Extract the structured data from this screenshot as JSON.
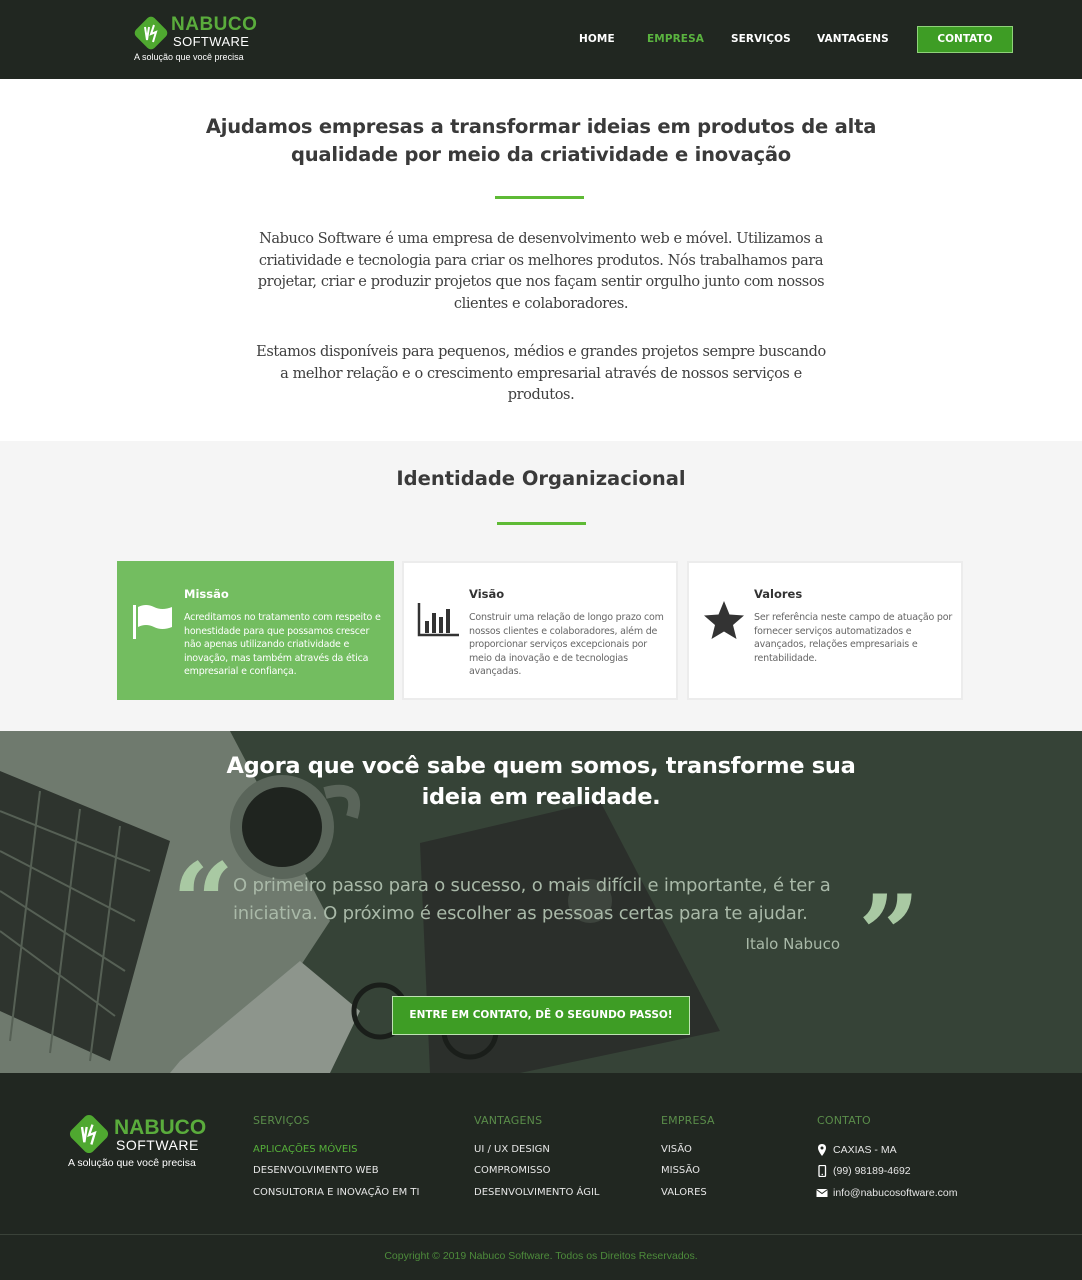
{
  "header": {
    "logo_name": "NABUCO",
    "logo_sub": "SOFTWARE",
    "logo_tagline": "A solução que você precisa",
    "nav": [
      {
        "label": "HOME",
        "active": false
      },
      {
        "label": "EMPRESA",
        "active": true
      },
      {
        "label": "SERVIÇOS",
        "active": false
      },
      {
        "label": "VANTAGENS",
        "active": false
      }
    ],
    "contact_button": "CONTATO"
  },
  "intro": {
    "title": "Ajudamos empresas a transformar ideias em produtos de alta qualidade por meio da criatividade e inovação",
    "paragraph1": "Nabuco Software é uma empresa de desenvolvimento web e móvel. Utilizamos a criatividade e tecnologia para criar os melhores produtos. Nós trabalhamos para projetar, criar e produzir projetos que nos façam sentir orgulho junto com nossos clientes e colaboradores.",
    "paragraph2": "Estamos disponíveis para pequenos, médios e grandes projetos sempre buscando a melhor relação e o crescimento empresarial através de nossos serviços e produtos."
  },
  "identity": {
    "title": "Identidade Organizacional",
    "cards": [
      {
        "title": "Missão",
        "icon": "flag-icon",
        "text": "Acreditamos no tratamento com respeito e honestidade para que possamos crescer não apenas utilizando criatividade e inovação, mas também através da ética empresarial e confiança."
      },
      {
        "title": "Visão",
        "icon": "bar-chart-icon",
        "text": "Construir uma relação de longo prazo com nossos clientes e colaboradores, além de proporcionar serviços excepcionais por meio da inovação e de tecnologias avançadas."
      },
      {
        "title": "Valores",
        "icon": "star-icon",
        "text": "Ser referência neste campo de atuação por fornecer serviços automatizados e avançados, relações empresariais e rentabilidade."
      }
    ]
  },
  "cta": {
    "title": "Agora que você sabe quem somos, transforme sua ideia em realidade.",
    "quote": "O primeiro passo para o sucesso, o mais difícil e importante, é ter a iniciativa. O próximo é escolher as pessoas certas para te ajudar.",
    "author": "Italo Nabuco",
    "button": "ENTRE EM CONTATO, DÊ O SEGUNDO PASSO!"
  },
  "footer": {
    "logo_name": "NABUCO",
    "logo_sub": "SOFTWARE",
    "logo_tagline": "A solução que você precisa",
    "servicos": {
      "heading": "SERVIÇOS",
      "items": [
        "APLICAÇÕES MÓVEIS",
        "DESENVOLVIMENTO WEB",
        "CONSULTORIA E INOVAÇÃO EM TI"
      ]
    },
    "vantagens": {
      "heading": "VANTAGENS",
      "items": [
        "UI / UX DESIGN",
        "COMPROMISSO",
        "DESENVOLVIMENTO ÁGIL"
      ]
    },
    "empresa": {
      "heading": "EMPRESA",
      "items": [
        "VISÃO",
        "MISSÃO",
        "VALORES"
      ]
    },
    "contato": {
      "heading": "CONTATO",
      "location": "CAXIAS - MA",
      "phone": "(99) 98189-4692",
      "email": "info@nabucosoftware.com"
    },
    "copyright": "Copyright © 2019 Nabuco Software. Todos os Direitos Reservados."
  },
  "colors": {
    "header_bg": "#212721",
    "accent_green": "#3e9d25",
    "active_green": "#5ab33f",
    "card_active": "#73bd60"
  }
}
